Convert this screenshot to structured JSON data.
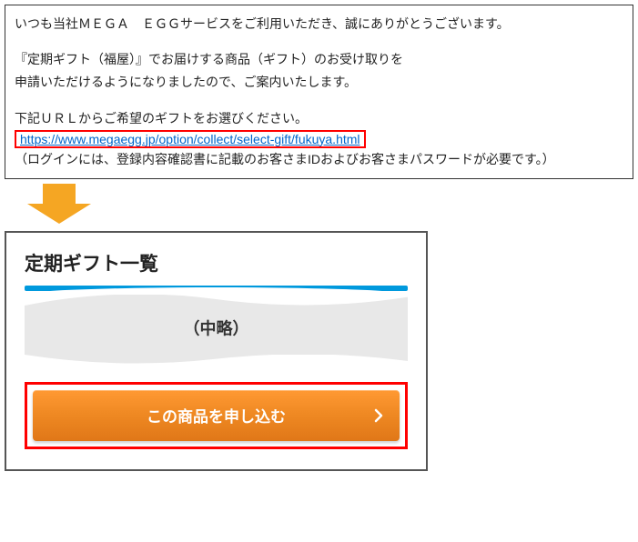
{
  "email": {
    "line1": "いつも当社ＭＥＧＡ　ＥＧＧサービスをご利用いただき、誠にありがとうございます。",
    "line2": "『定期ギフト（福屋）』でお届けする商品（ギフト）のお受け取りを",
    "line3": "申請いただけるようになりましたので、ご案内いたします。",
    "line4": "下記ＵＲＬからご希望のギフトをお選びください。",
    "url": "https://www.megaegg.jp/option/collect/select-gift/fukuya.html",
    "line5": "（ログインには、登録内容確認書に記載のお客さまIDおよびお客さまパスワードが必要です。）"
  },
  "panel": {
    "title": "定期ギフト一覧",
    "omitted": "（中略）",
    "button": "この商品を申し込む"
  },
  "colors": {
    "highlight": "#ff0000",
    "button_bg": "#ee8822",
    "accent_blue": "#0099dd",
    "arrow": "#f5a623"
  }
}
